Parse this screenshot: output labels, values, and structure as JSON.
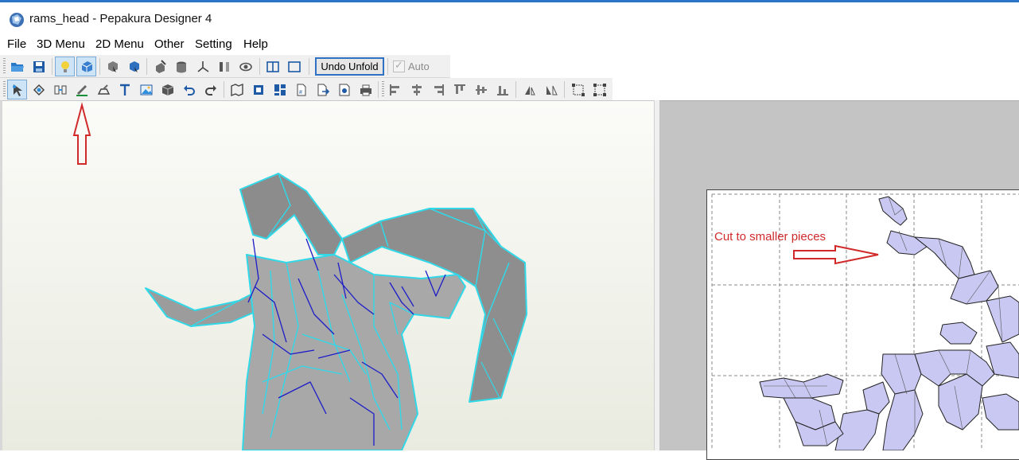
{
  "window": {
    "title": "rams_head - Pepakura Designer 4",
    "accent_color": "#2b74c7"
  },
  "menu": {
    "items": [
      "File",
      "3D Menu",
      "2D Menu",
      "Other",
      "Setting",
      "Help"
    ]
  },
  "toolbar1": {
    "undo_unfold_label": "Undo Unfold",
    "auto_label": "Auto",
    "auto_checked": true,
    "icons": [
      "open-file-icon",
      "save-icon",
      "light-icon",
      "texture-icon",
      "select-edit-icon",
      "display-icon",
      "edge-icon",
      "cylinder-icon",
      "axis-icon",
      "flip-icon",
      "eye-icon",
      "split-view-icon",
      "single-view-icon"
    ]
  },
  "toolbar2": {
    "icons": [
      "select-icon",
      "rotate-icon",
      "join-icon",
      "edge-edit-icon",
      "flap-icon",
      "text-icon",
      "image-icon",
      "box-icon",
      "undo-icon",
      "redo-icon",
      "unfold-icon",
      "fit-icon",
      "arrange-icon",
      "page-number-icon",
      "export-icon",
      "print-setup-icon",
      "print-icon",
      "align-left-icon",
      "align-center-icon",
      "align-right-icon",
      "align-top-icon",
      "align-middle-icon",
      "align-bottom-icon",
      "flip-h-icon",
      "flip-v-icon",
      "resize-icon",
      "grid-icon"
    ]
  },
  "annotations": {
    "cut_label": "Cut to smaller pieces",
    "color": "#d02a2a"
  },
  "colors": {
    "model_face": "#9a9a9a",
    "model_edge_cyan": "#30d8e8",
    "model_edge_blue": "#1c1cc8",
    "parts_fill": "#c9c8f2"
  }
}
